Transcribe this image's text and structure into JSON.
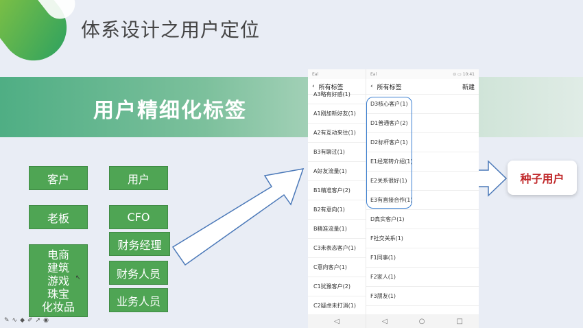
{
  "slide": {
    "title": "体系设计之用户定位",
    "banner": "用户精细化标签",
    "left_col": [
      "客户",
      "老板",
      [
        "电商",
        "建筑",
        "游戏",
        "珠宝",
        "化妆品"
      ]
    ],
    "mid_col": [
      "用户",
      "CFO",
      "财务经理",
      "财务人员",
      "业务人员"
    ],
    "seed_label": "种子用户"
  },
  "phone_left": {
    "status_left": "Eal",
    "back_icon": "‹",
    "nav_title": "所有标签",
    "items": [
      "A3略有好感(1)",
      "A1刚加新好友(1)",
      "A2有互动来往(1)",
      "B3有聊过(1)",
      "A好友流量(1)",
      "B1精准客户(2)",
      "B2有意向(1)",
      "B精准流量(1)",
      "C3未表态客户(1)",
      "C意向客户(1)",
      "C1犹豫客户(2)",
      "C2疑虑未打消(1)"
    ],
    "bottom_back": "◁"
  },
  "phone_right": {
    "status_left": "Eal",
    "status_right": "⊙ ▭ 10:41",
    "back_icon": "‹",
    "nav_title": "所有标签",
    "new_label": "新建",
    "items": [
      "D3核心客户(1)",
      "D1普通客户(2)",
      "D2标杆客户(1)",
      "E1经常转介绍(1)",
      "E2关系很好(1)",
      "E3有直接合作(1)",
      "D真实客户(1)",
      "F社交关系(1)",
      "F1同事(1)",
      "F2家人(1)",
      "F3朋友(1)"
    ],
    "bottom_back": "◁",
    "bottom_home": "○",
    "bottom_recent": "□"
  },
  "toolbar": {
    "pen": "✎",
    "curve": "∿",
    "eraser": "◆",
    "highlighter": "✐",
    "pointer": "➚",
    "target": "◉"
  },
  "cursor": "↖"
}
